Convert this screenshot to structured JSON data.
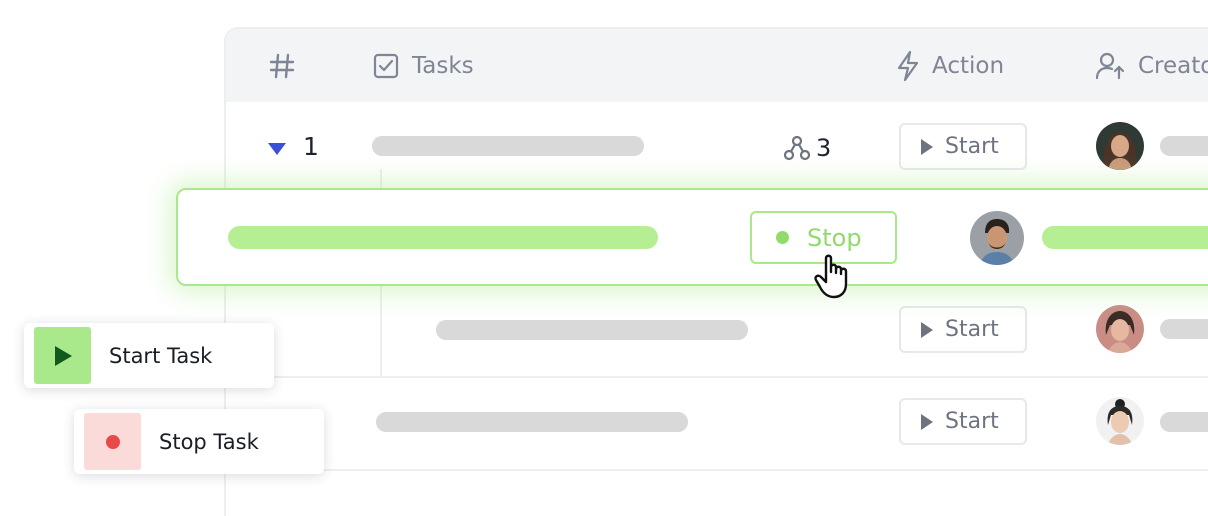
{
  "table": {
    "headers": {
      "index": "",
      "tasks": "Tasks",
      "action": "Action",
      "creator": "Creato"
    },
    "rows": [
      {
        "number": "1",
        "subtask_count": "3",
        "action_label": "Start"
      },
      {
        "action_label": "Start"
      },
      {
        "action_label": "Start"
      }
    ]
  },
  "dragged_row": {
    "action_label": "Stop"
  },
  "cards": {
    "start": {
      "label": "Start Task"
    },
    "stop": {
      "label": "Stop Task"
    }
  },
  "colors": {
    "accent_green": "#90db6c",
    "row_highlight_border": "#a9e88b",
    "expand_arrow": "#3b4fd8",
    "stop_red": "#e84a4a",
    "stop_card_bg": "#fbdada",
    "start_card_bg": "#a9e88b",
    "placeholder_grey": "#d9d9d9"
  }
}
